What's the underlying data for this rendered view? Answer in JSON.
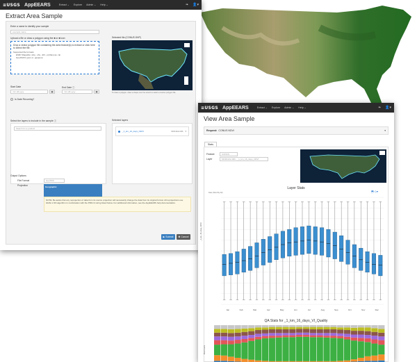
{
  "extract": {
    "topbar": {
      "logo": "≡USGS",
      "app": "AppEEARS",
      "nav": [
        "Extract ⌄",
        "Explore",
        "Admin ⌄",
        "Help ⌄"
      ],
      "icons": [
        "❧",
        "👤▾"
      ]
    },
    "title": "Extract Area Sample",
    "name_label": "Enter a name to identify your sample",
    "name_placeholder": "example name",
    "upload_label": "Upload a file or draw a polygon using the ■ or ■ icon",
    "upload_text": "Drop a vector polygon file containing the area feature(s) to extract or click here to select the file.",
    "upload_formats_label": "Supported file formats:",
    "upload_formats": [
      "ESRI Shapefile (.shp, .shx, .dbf, .prj files) as .zip",
      "GeoJSON (.json or .geojson)"
    ],
    "map_label": "Selected file (CONUS.SHP)",
    "map_caption": "To draw a polygon, draw a shape over the extent to select a custom polygon file.",
    "start_label": "Start Date",
    "end_label": "End Date ⓘ",
    "date_placeholder": "mm-dd-yyyy",
    "recurring_label": "Is Date Recurring?",
    "layers_label": "Select the layers to include in the sample ⓘ",
    "layers_search": "Search for a product",
    "selected_layers_label": "Selected layers",
    "selected_layer": "_1_km_16_days_NDVI",
    "selected_layer_product": "MOD13A2.006",
    "output_label": "Output Options",
    "file_format_label": "File Format",
    "file_format_value": "GeoTIFF",
    "projection_label": "Projection",
    "projection_title": "Geographic",
    "note_text": "NOTE: Be aware that any reprojection of data from its source projection will necessarily change the data from its original format. All reprojections use GDAL's NN algorithm in combination with the PROJ.4 string listed below. For additional information, see the AppEEARS help documentation.",
    "submit_label": "▶ Submit",
    "cancel_label": "✖ Cancel"
  },
  "view": {
    "topbar": {
      "logo": "≡USGS",
      "app": "AppEEARS",
      "nav": [
        "Extract ⌄",
        "Explore",
        "Admin ⌄",
        "Help ⌄"
      ],
      "icons": [
        "❧",
        "👤▾"
      ]
    },
    "title": "View Area Sample",
    "request_label": "Request:",
    "request_value": "CONUS NDVI",
    "tab": "Stats",
    "feature_label": "Feature",
    "feature_value": "CONUS",
    "layer_label": "Layer",
    "layer_value": "MOD13A2.006 - _1_km_16_days_NDVI",
    "layer_stats_title": "Layer Stats",
    "layer_stats_sub": "Date (Monthly All)",
    "qa_title": "QA Stats for _1_km_16_days_VI_Quality"
  },
  "chart_data": [
    {
      "type": "box",
      "title": "Layer Stats",
      "ylabel": "_1_km_16_days_NDVI",
      "categories": [
        "Jan",
        "Feb",
        "Mar",
        "Apr",
        "May",
        "Jun",
        "Jul",
        "Aug",
        "Sep",
        "Oct",
        "Nov",
        "Dec"
      ],
      "box_count": 25,
      "values": [
        {
          "q1": 0.12,
          "median": 0.25,
          "q3": 0.36
        },
        {
          "q1": 0.13,
          "median": 0.26,
          "q3": 0.37
        },
        {
          "q1": 0.14,
          "median": 0.27,
          "q3": 0.39
        },
        {
          "q1": 0.16,
          "median": 0.29,
          "q3": 0.42
        },
        {
          "q1": 0.18,
          "median": 0.31,
          "q3": 0.45
        },
        {
          "q1": 0.21,
          "median": 0.34,
          "q3": 0.49
        },
        {
          "q1": 0.24,
          "median": 0.38,
          "q3": 0.53
        },
        {
          "q1": 0.27,
          "median": 0.41,
          "q3": 0.56
        },
        {
          "q1": 0.3,
          "median": 0.44,
          "q3": 0.59
        },
        {
          "q1": 0.32,
          "median": 0.47,
          "q3": 0.62
        },
        {
          "q1": 0.34,
          "median": 0.49,
          "q3": 0.64
        },
        {
          "q1": 0.35,
          "median": 0.5,
          "q3": 0.66
        },
        {
          "q1": 0.36,
          "median": 0.51,
          "q3": 0.67
        },
        {
          "q1": 0.37,
          "median": 0.52,
          "q3": 0.68
        },
        {
          "q1": 0.36,
          "median": 0.51,
          "q3": 0.67
        },
        {
          "q1": 0.35,
          "median": 0.5,
          "q3": 0.66
        },
        {
          "q1": 0.33,
          "median": 0.48,
          "q3": 0.64
        },
        {
          "q1": 0.31,
          "median": 0.46,
          "q3": 0.61
        },
        {
          "q1": 0.28,
          "median": 0.42,
          "q3": 0.57
        },
        {
          "q1": 0.25,
          "median": 0.38,
          "q3": 0.52
        },
        {
          "q1": 0.21,
          "median": 0.34,
          "q3": 0.47
        },
        {
          "q1": 0.18,
          "median": 0.3,
          "q3": 0.43
        },
        {
          "q1": 0.16,
          "median": 0.27,
          "q3": 0.39
        },
        {
          "q1": 0.14,
          "median": 0.25,
          "q3": 0.37
        },
        {
          "q1": 0.12,
          "median": 0.24,
          "q3": 0.35
        }
      ],
      "ylim": [
        -0.2,
        1.0
      ]
    },
    {
      "type": "stacked-bar",
      "title": "QA Stats for _1_km_16_days_VI_Quality",
      "ylabel": "Pixel Count",
      "bars": 25,
      "series": [
        {
          "color": "#2e7bbf",
          "values": [
            0.05,
            0.05,
            0.04,
            0.03,
            0.02,
            0.02,
            0.02,
            0.02,
            0.02,
            0.02,
            0.02,
            0.02,
            0.02,
            0.02,
            0.02,
            0.02,
            0.02,
            0.02,
            0.02,
            0.02,
            0.03,
            0.04,
            0.05,
            0.05,
            0.06
          ]
        },
        {
          "color": "#f28e2b",
          "values": [
            0.15,
            0.14,
            0.12,
            0.1,
            0.08,
            0.06,
            0.04,
            0.03,
            0.02,
            0.02,
            0.02,
            0.02,
            0.02,
            0.02,
            0.02,
            0.02,
            0.02,
            0.02,
            0.03,
            0.04,
            0.06,
            0.09,
            0.12,
            0.14,
            0.16
          ]
        },
        {
          "color": "#3cb043",
          "values": [
            0.28,
            0.3,
            0.33,
            0.38,
            0.44,
            0.5,
            0.56,
            0.6,
            0.62,
            0.63,
            0.64,
            0.64,
            0.65,
            0.65,
            0.64,
            0.64,
            0.63,
            0.62,
            0.6,
            0.56,
            0.5,
            0.44,
            0.38,
            0.32,
            0.26
          ]
        },
        {
          "color": "#e15759",
          "values": [
            0.12,
            0.11,
            0.1,
            0.1,
            0.09,
            0.08,
            0.07,
            0.06,
            0.06,
            0.05,
            0.05,
            0.05,
            0.05,
            0.05,
            0.05,
            0.05,
            0.05,
            0.06,
            0.06,
            0.07,
            0.08,
            0.09,
            0.1,
            0.11,
            0.12
          ]
        },
        {
          "color": "#9c6ade",
          "values": [
            0.1,
            0.1,
            0.1,
            0.09,
            0.09,
            0.08,
            0.08,
            0.07,
            0.07,
            0.07,
            0.06,
            0.06,
            0.06,
            0.06,
            0.06,
            0.06,
            0.07,
            0.07,
            0.07,
            0.08,
            0.08,
            0.09,
            0.09,
            0.1,
            0.1
          ]
        },
        {
          "color": "#8c564b",
          "values": [
            0.1,
            0.1,
            0.1,
            0.1,
            0.1,
            0.1,
            0.1,
            0.1,
            0.1,
            0.1,
            0.1,
            0.1,
            0.1,
            0.1,
            0.1,
            0.1,
            0.1,
            0.1,
            0.1,
            0.1,
            0.1,
            0.1,
            0.1,
            0.1,
            0.1
          ]
        },
        {
          "color": "#bcbd22",
          "values": [
            0.1,
            0.1,
            0.1,
            0.1,
            0.09,
            0.08,
            0.07,
            0.06,
            0.06,
            0.06,
            0.06,
            0.06,
            0.05,
            0.05,
            0.06,
            0.06,
            0.06,
            0.06,
            0.06,
            0.07,
            0.08,
            0.09,
            0.1,
            0.1,
            0.1
          ]
        },
        {
          "color": "#c7c7c7",
          "values": [
            0.1,
            0.1,
            0.11,
            0.1,
            0.09,
            0.08,
            0.06,
            0.06,
            0.05,
            0.05,
            0.05,
            0.05,
            0.05,
            0.05,
            0.05,
            0.05,
            0.05,
            0.05,
            0.06,
            0.06,
            0.07,
            0.06,
            0.06,
            0.08,
            0.1
          ]
        }
      ]
    }
  ]
}
